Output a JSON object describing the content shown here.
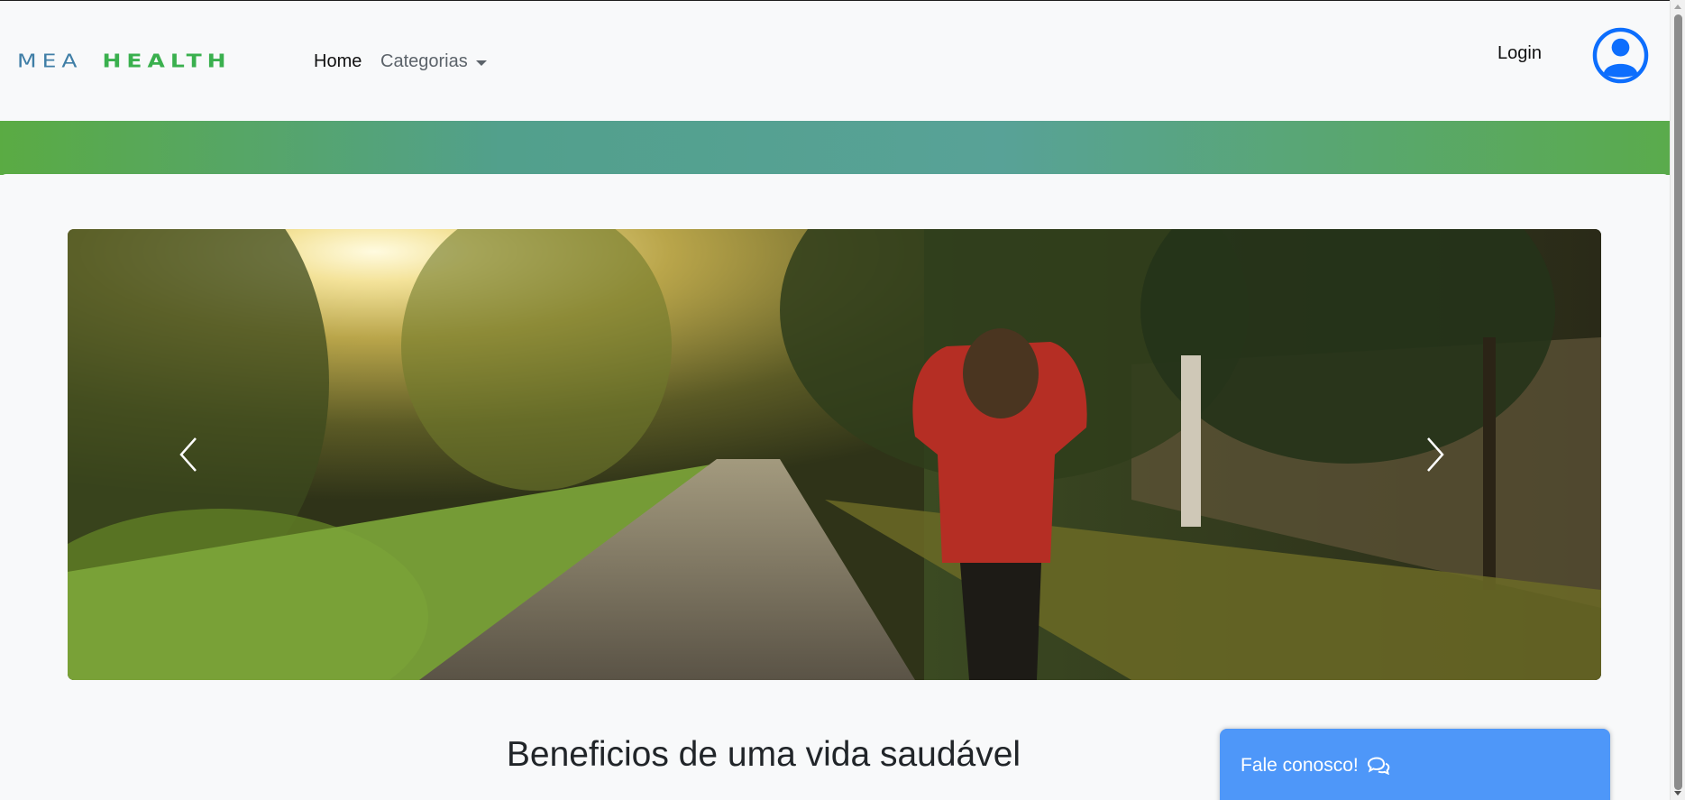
{
  "navbar": {
    "brand_part1": "MEA",
    "brand_part2": "HEALTH",
    "home_label": "Home",
    "categorias_label": "Categorias",
    "login_label": "Login",
    "avatar_icon": "user-circle-icon"
  },
  "colors": {
    "brand_blue": "#3f7ea6",
    "brand_green": "#3ab04e",
    "band_green": "#5aab43",
    "band_teal": "#52a08c",
    "chat_blue": "#4e97f9",
    "avatar_blue": "#0d6efd"
  },
  "carousel": {
    "image_alt": "Mulher de moletom vermelho caminhando em estrada rural ao pôr do sol",
    "prev_icon": "chevron-left-icon",
    "next_icon": "chevron-right-icon"
  },
  "main": {
    "section_title": "Beneficios de uma vida saudável"
  },
  "chat": {
    "label": "Fale conosco!",
    "icon": "chat-bubbles-icon"
  }
}
